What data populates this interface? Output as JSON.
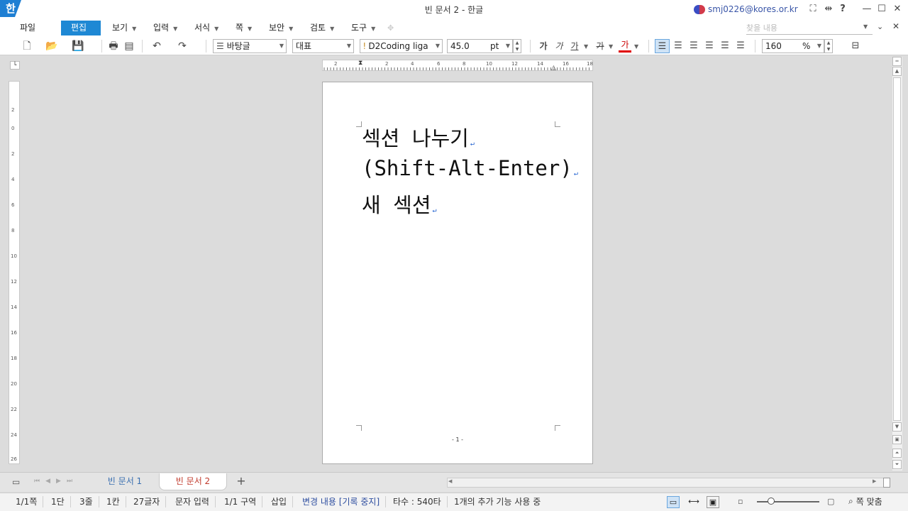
{
  "app": {
    "icon": "한",
    "window_title": "빈 문서 2 - 한글",
    "user_email": "smj0226@kores.or.kr"
  },
  "title_icons": {
    "fullscreen": "⛶",
    "resize": "⇹",
    "help": "?",
    "minimize": "—",
    "maximize": "☐",
    "close": "✕"
  },
  "menus": [
    {
      "label": "파일"
    },
    {
      "label": "편집"
    },
    {
      "label": "보기"
    },
    {
      "label": "입력"
    },
    {
      "label": "서식"
    },
    {
      "label": "쪽"
    },
    {
      "label": "보안"
    },
    {
      "label": "검토"
    },
    {
      "label": "도구"
    }
  ],
  "search": {
    "placeholder": "찾을 내용"
  },
  "toolbar": {
    "style": "바탕글",
    "lang_font": "대표",
    "font_name": "D2Coding liga",
    "font_size": "45.0",
    "font_unit": "pt",
    "bold": "가",
    "italic": "가",
    "underline": "가",
    "strike": "가",
    "color": "가",
    "zoom": "160",
    "zoom_unit": "%"
  },
  "ruler": {
    "h_marks": [
      "2",
      "2",
      "4",
      "6",
      "8",
      "10",
      "12",
      "14",
      "16",
      "18"
    ],
    "v_marks": [
      "2",
      "0",
      "2",
      "4",
      "6",
      "8",
      "10",
      "12",
      "14",
      "16",
      "18",
      "20",
      "22",
      "24",
      "26"
    ]
  },
  "document": {
    "lines": [
      "섹션 나누기",
      "(Shift-Alt-Enter)",
      "새 섹션"
    ],
    "return_mark": "↵",
    "page_number": "- 1 -"
  },
  "tabs": [
    {
      "label": "빈 문서 1"
    },
    {
      "label": "빈 문서 2"
    }
  ],
  "add_tab": "+",
  "status": {
    "page": "1/1쪽",
    "column": "1단",
    "line": "3줄",
    "col": "1칸",
    "chars": "27글자",
    "mode": "문자 입력",
    "section": "1/1 구역",
    "insert": "삽입",
    "track": "변경 내용 [기록 중지]",
    "typing": "타수 : 540타",
    "addons": "1개의 추가 기능 사용 중",
    "fit": "쪽 맞춤"
  },
  "colors": {
    "accent": "#1e88d4",
    "active_tab": "#c0392b",
    "inactive_tab": "#3a6fb0",
    "user": "#3a56a8"
  }
}
